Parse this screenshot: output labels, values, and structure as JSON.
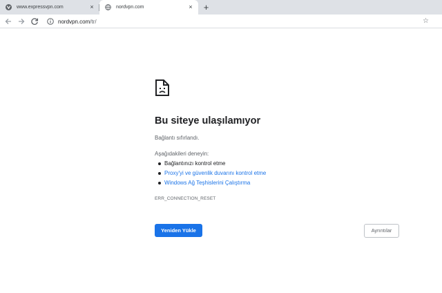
{
  "tabs": [
    {
      "title": "www.expressvpn.com",
      "close": "×",
      "active": false
    },
    {
      "title": "nordvpn.com",
      "close": "×",
      "active": true
    }
  ],
  "new_tab_label": "+",
  "toolbar": {
    "back_icon": "arrow-left",
    "forward_icon": "arrow-right",
    "reload_icon": "refresh",
    "url_host": "nordvpn.com",
    "url_path": "/tr/",
    "star_glyph": "☆"
  },
  "error": {
    "icon": "sad-page",
    "headline": "Bu siteye ulaşılamıyor",
    "description": "Bağlantı sıfırlandı.",
    "try_heading": "Aşağıdakileri deneyin:",
    "suggestions": [
      {
        "text": "Bağlantınızı kontrol etme",
        "link": false
      },
      {
        "text": "Proxy'yi ve güvenlik duvarını kontrol etme",
        "link": true
      },
      {
        "text": "Windows Ağ Teşhislerini Çalıştırma",
        "link": true
      }
    ],
    "code": "ERR_CONNECTION_RESET"
  },
  "buttons": {
    "reload": "Yeniden Yükle",
    "details": "Ayrıntılar"
  },
  "colors": {
    "accent": "#1a73e8",
    "tabstrip": "#dee1e6",
    "link": "#1a73e8"
  }
}
